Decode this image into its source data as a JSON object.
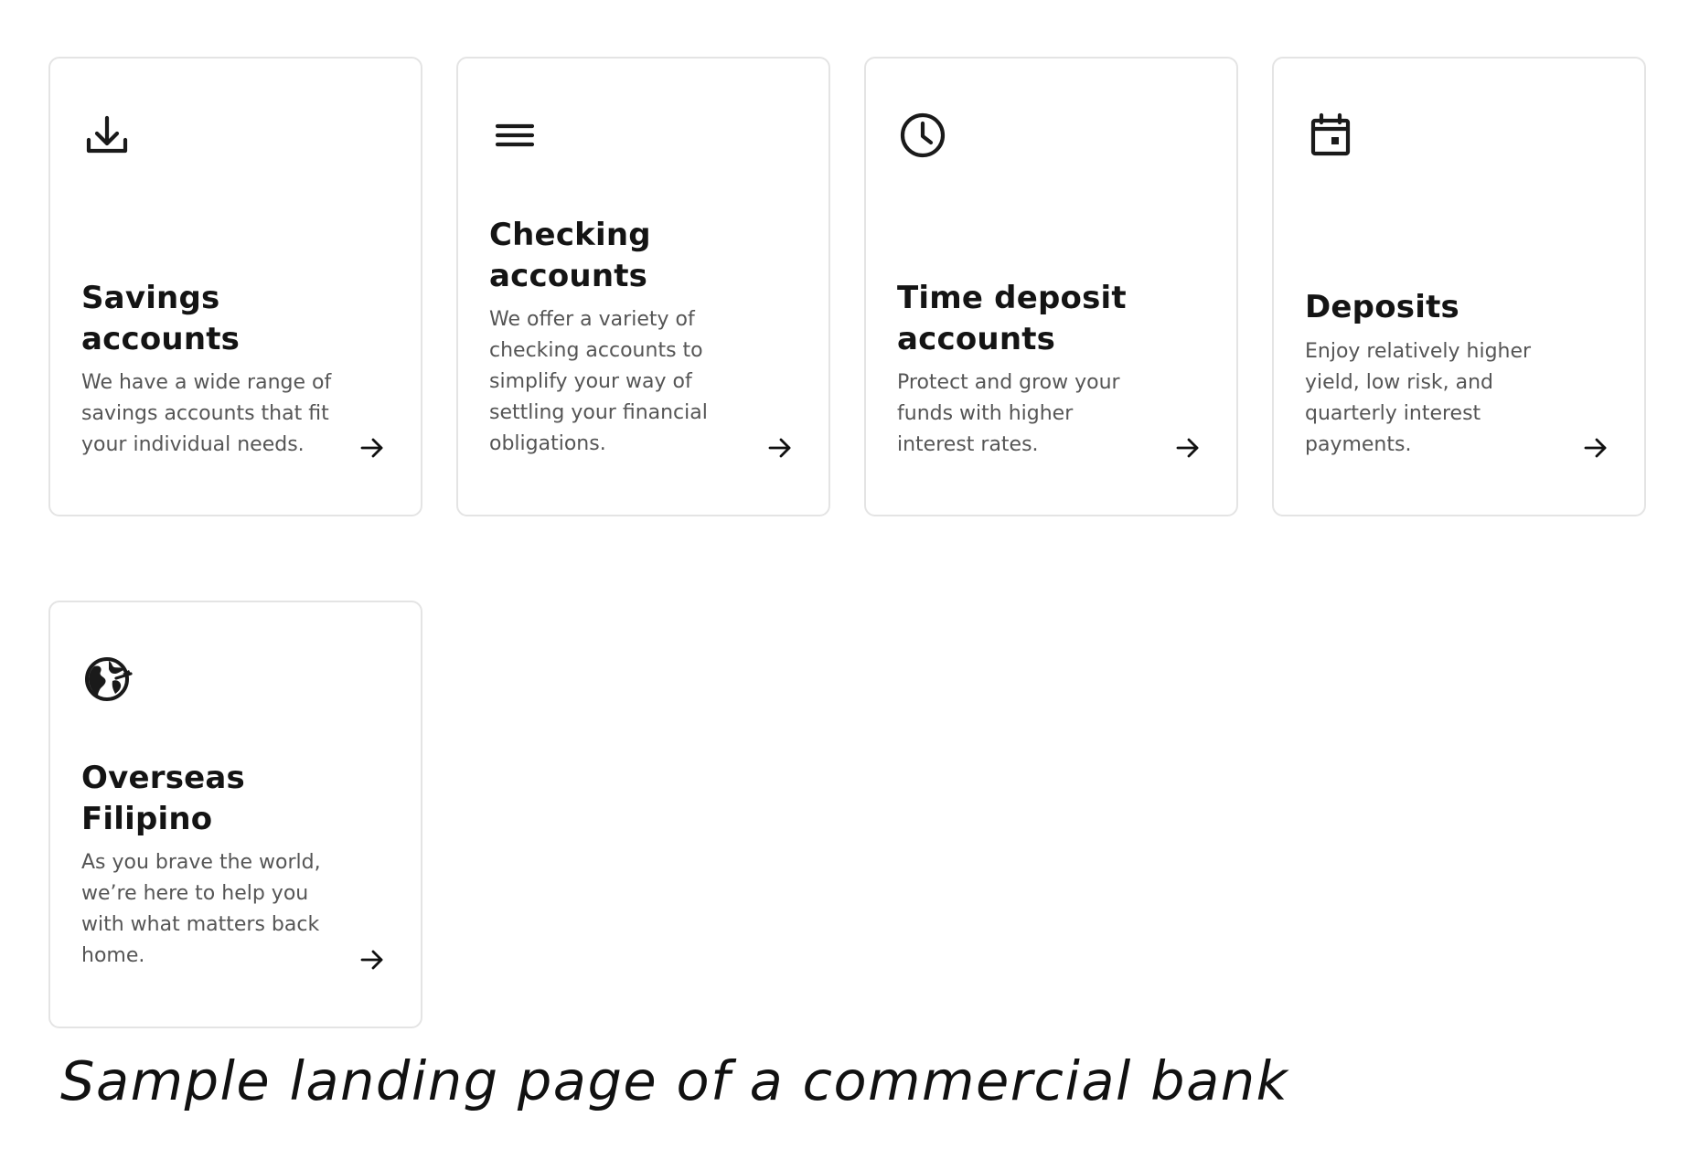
{
  "cards": [
    {
      "icon": "download-icon",
      "title": "Savings accounts",
      "description": "We have a wide range of savings accounts that fit your individual needs."
    },
    {
      "icon": "menu-lines-icon",
      "title": "Checking accounts",
      "description": "We offer a variety of checking accounts to simplify your way of settling your financial obligations."
    },
    {
      "icon": "clock-icon",
      "title": "Time deposit accounts",
      "description": "Protect and grow your funds with higher interest rates."
    },
    {
      "icon": "calendar-icon",
      "title": "Deposits",
      "description": "Enjoy relatively higher yield, low risk, and quarterly interest payments."
    },
    {
      "icon": "globe-icon",
      "title": "Overseas Filipino",
      "description": "As you brave the world, we’re here to help you with what matters back home."
    }
  ],
  "caption": "Sample landing page of a commercial bank"
}
